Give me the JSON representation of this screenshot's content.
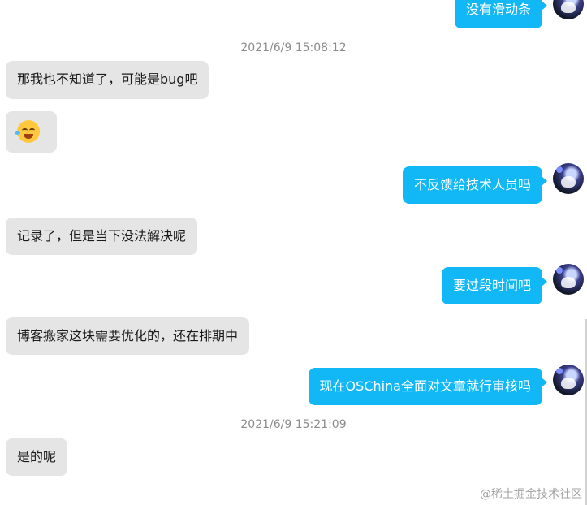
{
  "messages": [
    {
      "side": "right",
      "text": "没有滑动条"
    },
    {
      "side": "ts",
      "text": "2021/6/9 15:08:12"
    },
    {
      "side": "left",
      "text": "那我也不知道了，可能是bug吧"
    },
    {
      "side": "left",
      "emoji": "laughing-crying-face-icon"
    },
    {
      "side": "right",
      "text": "不反馈给技术人员吗"
    },
    {
      "side": "left",
      "text": "记录了，但是当下没法解决呢"
    },
    {
      "side": "right",
      "text": "要过段时间吧"
    },
    {
      "side": "left",
      "text": "博客搬家这块需要优化的，还在排期中"
    },
    {
      "side": "right",
      "text": "现在OSChina全面对文章就行审核吗"
    },
    {
      "side": "ts",
      "text": "2021/6/9 15:21:09"
    },
    {
      "side": "left",
      "text": "是的呢"
    }
  ],
  "watermark": "@稀土掘金技术社区",
  "colors": {
    "incoming": "#e5e5e5",
    "outgoing": "#12b7f5",
    "timestamp": "#8c8c8c"
  }
}
